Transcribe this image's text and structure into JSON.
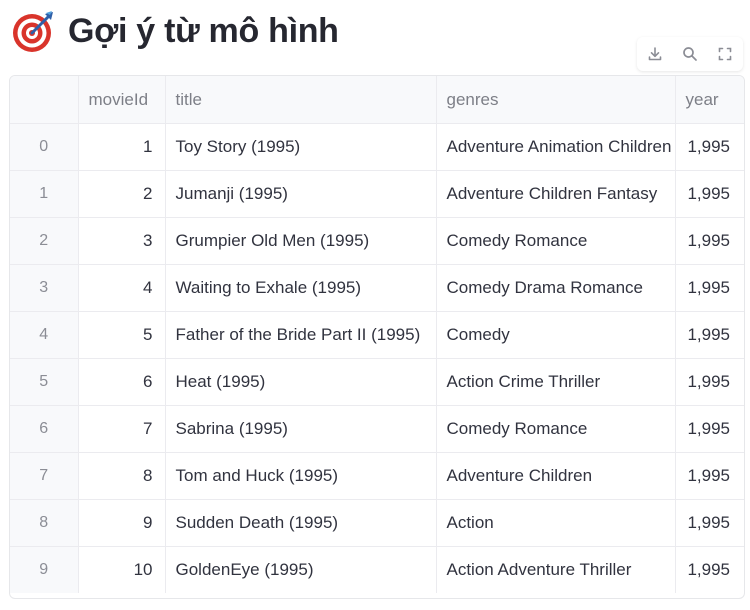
{
  "page": {
    "title": "Gợi ý từ mô hình",
    "title_icon": "dart-target-icon"
  },
  "toolbar": {
    "icons": [
      "download-icon",
      "search-icon",
      "fullscreen-icon"
    ]
  },
  "table": {
    "columns": [
      "",
      "movieId",
      "title",
      "genres",
      "year"
    ],
    "rows": [
      {
        "index": "0",
        "movieId": "1",
        "title": "Toy Story (1995)",
        "genres": "Adventure Animation Children Comedy Fantasy",
        "year": "1,995"
      },
      {
        "index": "1",
        "movieId": "2",
        "title": "Jumanji (1995)",
        "genres": "Adventure Children Fantasy",
        "year": "1,995"
      },
      {
        "index": "2",
        "movieId": "3",
        "title": "Grumpier Old Men (1995)",
        "genres": "Comedy Romance",
        "year": "1,995"
      },
      {
        "index": "3",
        "movieId": "4",
        "title": "Waiting to Exhale (1995)",
        "genres": "Comedy Drama Romance",
        "year": "1,995"
      },
      {
        "index": "4",
        "movieId": "5",
        "title": "Father of the Bride Part II (1995)",
        "genres": "Comedy",
        "year": "1,995"
      },
      {
        "index": "5",
        "movieId": "6",
        "title": "Heat (1995)",
        "genres": "Action Crime Thriller",
        "year": "1,995"
      },
      {
        "index": "6",
        "movieId": "7",
        "title": "Sabrina (1995)",
        "genres": "Comedy Romance",
        "year": "1,995"
      },
      {
        "index": "7",
        "movieId": "8",
        "title": "Tom and Huck (1995)",
        "genres": "Adventure Children",
        "year": "1,995"
      },
      {
        "index": "8",
        "movieId": "9",
        "title": "Sudden Death (1995)",
        "genres": "Action",
        "year": "1,995"
      },
      {
        "index": "9",
        "movieId": "10",
        "title": "GoldenEye (1995)",
        "genres": "Action Adventure Thriller",
        "year": "1,995"
      }
    ]
  },
  "colors": {
    "header_bg": "#f8f9fb",
    "border": "#e6e7ea",
    "text": "#31333f",
    "muted": "#7d7f87"
  }
}
